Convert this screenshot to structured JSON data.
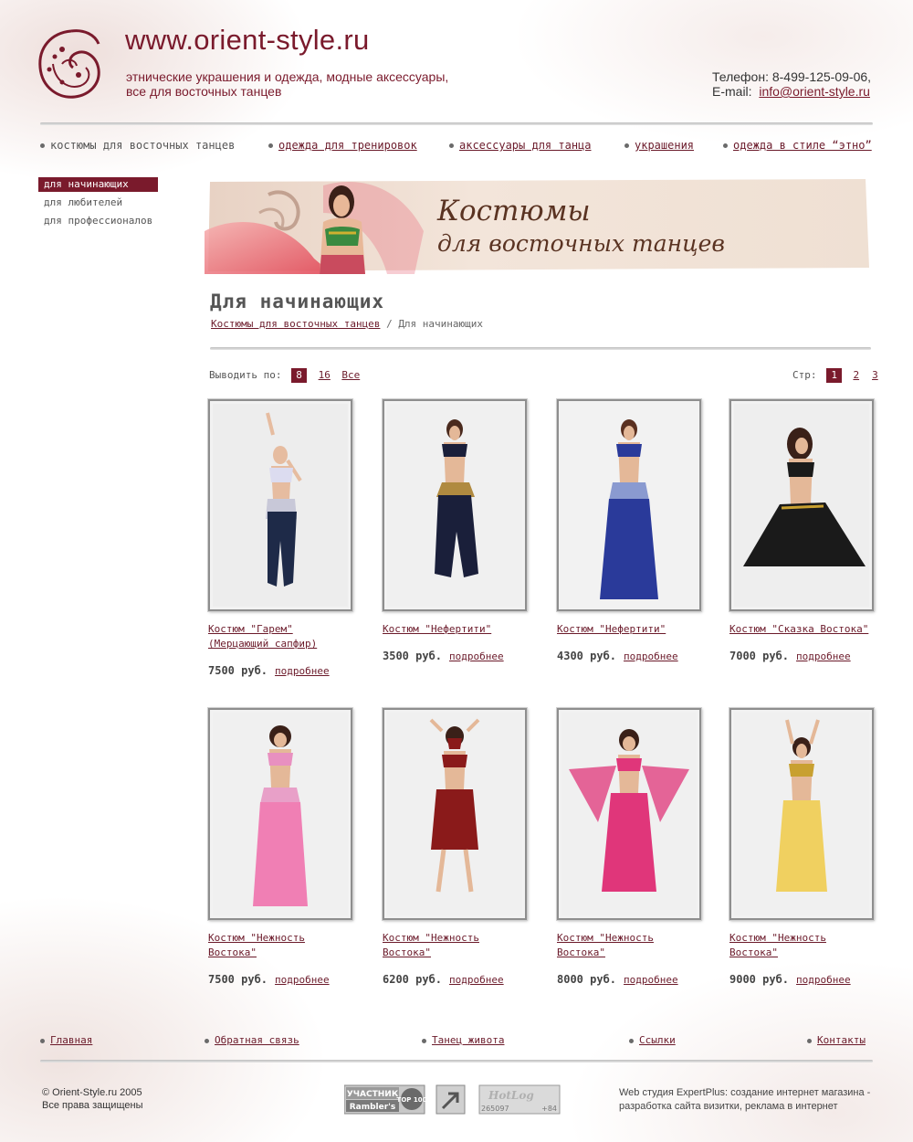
{
  "header": {
    "site_title": "www.orient-style.ru",
    "tagline_line1": "этнические украшения и одежда, модные аксессуары,",
    "tagline_line2": "все для восточных танцев",
    "phone": "Телефон: 8-499-125-09-06,",
    "email_label": "E-mail:",
    "email": "info@orient-style.ru"
  },
  "top_nav": [
    {
      "label": "костюмы для восточных танцев",
      "active": true
    },
    {
      "label": "одежда для тренировок"
    },
    {
      "label": "аксессуары для танца"
    },
    {
      "label": "украшения"
    },
    {
      "label": "одежда в стиле “этно”"
    }
  ],
  "side_nav": [
    {
      "label": "для начинающих",
      "active": true
    },
    {
      "label": "для любителей"
    },
    {
      "label": "для профессионалов"
    }
  ],
  "banner": {
    "line1": "Костюмы",
    "line2": "для восточных танцев"
  },
  "page": {
    "heading": "Для начинающих",
    "breadcrumb_link": "Костюмы для восточных танцев",
    "breadcrumb_sep": "/",
    "breadcrumb_current": "Для начинающих"
  },
  "pager": {
    "show_label": "Выводить по:",
    "show_options": [
      "8",
      "16",
      "Все"
    ],
    "show_active": "8",
    "pages_label": "Стр:",
    "pages": [
      "1",
      "2",
      "3"
    ],
    "page_active": "1"
  },
  "products": [
    {
      "name_line1": "Костюм \"Гарем\"",
      "name_line2": "(Мерцающий сапфир)",
      "price": "7500 руб.",
      "more": "подробнее"
    },
    {
      "name_line1": "Костюм \"Нефертити\"",
      "name_line2": "",
      "price": "3500 руб.",
      "more": "подробнее"
    },
    {
      "name_line1": "Костюм \"Нефертити\"",
      "name_line2": "",
      "price": "4300 руб.",
      "more": "подробнее"
    },
    {
      "name_line1": "Костюм \"Сказка Востока\"",
      "name_line2": "",
      "price": "7000 руб.",
      "more": "подробнее"
    },
    {
      "name_line1": "Костюм \"Нежность",
      "name_line2": "Востока\"",
      "price": "7500 руб.",
      "more": "подробнее"
    },
    {
      "name_line1": "Костюм \"Нежность",
      "name_line2": "Востока\"",
      "price": "6200 руб.",
      "more": "подробнее"
    },
    {
      "name_line1": "Костюм \"Нежность",
      "name_line2": "Востока\"",
      "price": "8000 руб.",
      "more": "подробнее"
    },
    {
      "name_line1": "Костюм \"Нежность",
      "name_line2": "Востока\"",
      "price": "9000 руб.",
      "more": "подробнее"
    }
  ],
  "costume_colors": {
    "p1": "#1e2a48",
    "p2": "#1a1f3a",
    "p3": "#2a3a9a",
    "p4": "#1a1a1a",
    "p5": "#f07fb4",
    "p6": "#8a1a1a",
    "p7": "#e0367a",
    "p8": "#f0d060"
  },
  "bottom_nav": [
    "Главная",
    "Обратная связь",
    "Танец живота",
    "Ссылки",
    "Контакты"
  ],
  "footer": {
    "copyright": "© Orient-Style.ru 2005",
    "rights": "Все права защищены",
    "rambler_top": "УЧАСТНИК",
    "rambler_bottom": "Rambler's",
    "rambler_badge": "TOP 100",
    "hotlog_title": "HotLog",
    "hotlog_count": "265097",
    "hotlog_delta": "+84",
    "studio_line1": "Web студия ExpertPlus: создание интернет магазина -",
    "studio_line2": "разработка сайта визитки, реклама в интернет"
  },
  "colors": {
    "accent": "#7a1a2c",
    "text": "#333333"
  }
}
